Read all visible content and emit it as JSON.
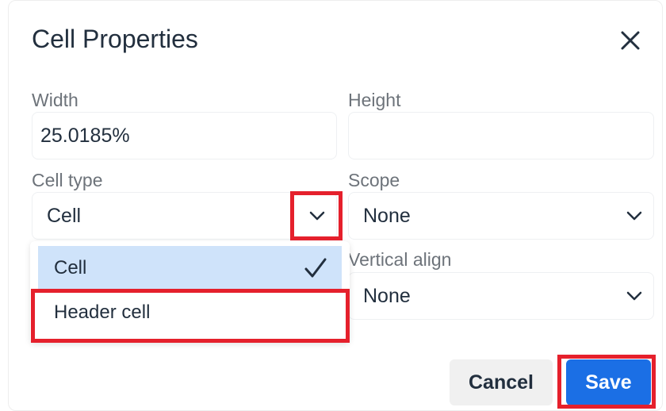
{
  "dialog": {
    "title": "Cell Properties",
    "close_icon": "close-icon"
  },
  "fields": {
    "width": {
      "label": "Width",
      "value": "25.0185%"
    },
    "height": {
      "label": "Height",
      "value": ""
    },
    "cell_type": {
      "label": "Cell type",
      "value": "Cell"
    },
    "scope": {
      "label": "Scope",
      "value": "None"
    },
    "vertical_align": {
      "label": "Vertical align",
      "value": "None"
    }
  },
  "dropdown": {
    "options": [
      {
        "label": "Cell",
        "selected": true
      },
      {
        "label": "Header cell",
        "selected": false
      }
    ]
  },
  "buttons": {
    "cancel": "Cancel",
    "save": "Save"
  },
  "colors": {
    "accent": "#1b6fe5",
    "highlight": "#e5202c",
    "selected_bg": "#cfe3fa"
  }
}
